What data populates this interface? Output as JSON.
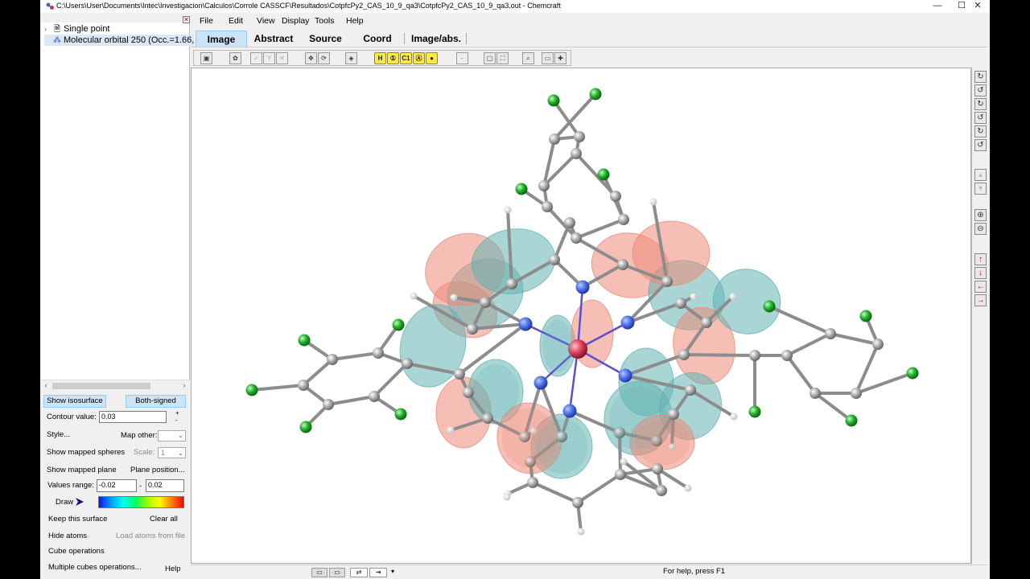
{
  "window": {
    "title": "C:\\Users\\User\\Documents\\Intec\\Investigacion\\Calculos\\Corrole CASSCF\\Resultados\\CotpfcPy2_CAS_10_9_qa3\\CotpfcPy2_CAS_10_9_qa3.out - Chemcraft",
    "minimize": "—",
    "maximize": "☐",
    "close": "✕"
  },
  "tree": {
    "close_glyph": "✕",
    "items": [
      {
        "expander": "›",
        "icon": "🗎",
        "label": "Single point"
      },
      {
        "expander": "",
        "icon": "⁂",
        "label": "Molecular orbital  250 (Occ.=1.66,"
      }
    ]
  },
  "scroll": {
    "left": "‹",
    "right": "›"
  },
  "controls": {
    "show_isosurface": "Show isosurface",
    "both_signed": "Both-signed",
    "contour_label": "Contour value:",
    "contour_value": "0.03",
    "spin_up": "+",
    "spin_down": "-",
    "style": "Style...",
    "map_other": "Map other:",
    "show_mapped_spheres": "Show mapped spheres",
    "scale_label": "Scale:",
    "scale_value": "1",
    "show_mapped_plane": "Show mapped plane",
    "plane_position": "Plane position...",
    "values_range_label": "Values range:",
    "range_min": "-0.02",
    "range_dash": "-",
    "range_max": "0.02",
    "draw": "Draw",
    "keep_surface": "Keep this surface",
    "clear_all": "Clear all",
    "hide_atoms": "Hide atoms",
    "load_atoms": "Load atoms from file",
    "cube_operations": "Cube operations",
    "multiple_cubes": "Multiple cubes operations...",
    "help": "Help"
  },
  "menu": [
    "File",
    "Edit",
    "View",
    "Display",
    "Tools",
    "Help"
  ],
  "tabs": [
    {
      "label": "Image",
      "active": true
    },
    {
      "label": "Abstract",
      "active": false
    },
    {
      "label": "Source",
      "active": false
    },
    {
      "label": "Coord",
      "active": false
    },
    {
      "label": "Image/abs.",
      "active": false
    }
  ],
  "toolbar": {
    "yellow_buttons": [
      "H",
      "①",
      "C1",
      "Ⓐ",
      "●"
    ]
  },
  "status": {
    "text": "For help, press F1"
  },
  "colors": {
    "accent_tab": "#cce4f7",
    "lobe_positive": "#ee8a78",
    "lobe_negative": "#63b3b3",
    "carbon": "#9a9a9a",
    "nitrogen": "#4f73e8",
    "chlorine": "#1fb02a",
    "cobalt": "#e0405a"
  }
}
